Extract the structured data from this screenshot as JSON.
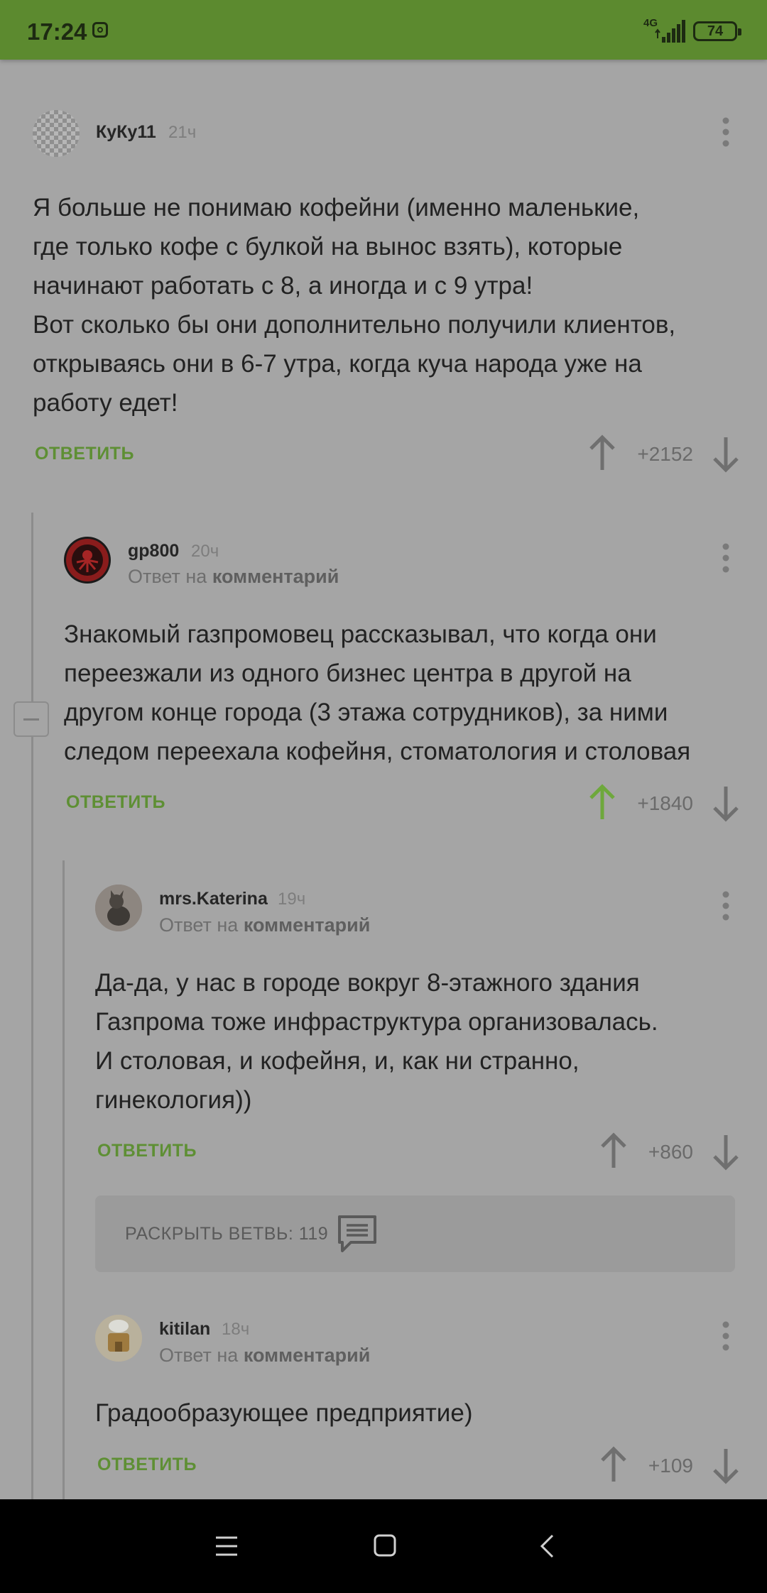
{
  "status_bar": {
    "time": "17:24",
    "network": "4G",
    "battery": "74",
    "bg_color": "#5c8a2f"
  },
  "comments": [
    {
      "author": "КуКу11",
      "age": "21ч",
      "text": [
        "Я больше не понимаю кофейни (именно маленькие,",
        "где только кофе с булкой на вынос взять), которые",
        "начинают работать с 8, а иногда и с 9 утра!",
        "Вот сколько бы они дополнительно получили клиентов,",
        "открываясь они в 6-7 утра, когда куча народа уже на",
        "работу едет!"
      ],
      "reply_label": "ОТВЕТИТЬ",
      "score": "+2152"
    },
    {
      "author": "gp800",
      "age": "20ч",
      "reply_prefix": "Ответ на",
      "reply_link": "комментарий",
      "text": [
        "Знакомый газпромовец рассказывал, что когда они",
        "переезжали из одного бизнес центра в другой на",
        "другом конце города (3 этажа сотрудников), за ними",
        "следом переехала кофейня, стоматология и столовая"
      ],
      "reply_label": "ОТВЕТИТЬ",
      "score": "+1840",
      "upvoted": true
    },
    {
      "author": "mrs.Katerina",
      "age": "19ч",
      "reply_prefix": "Ответ на",
      "reply_link": "комментарий",
      "text": [
        "Да-да, у нас в городе вокруг 8-этажного здания",
        "Газпрома тоже инфраструктура организовалась.",
        "И столовая, и кофейня, и, как ни странно,",
        "гинекология))"
      ],
      "reply_label": "ОТВЕТИТЬ",
      "score": "+860"
    },
    {
      "author": "kitilan",
      "age": "18ч",
      "reply_prefix": "Ответ на",
      "reply_link": "комментарий",
      "text": [
        "Градообразующее предприятие)"
      ],
      "reply_label": "ОТВЕТИТЬ",
      "score": "+109"
    }
  ],
  "expand_branch": {
    "label": "РАСКРЫТЬ ВЕТВЬ: 119"
  },
  "colors": {
    "accent_green": "#5e8f34",
    "upvote_active": "#6ea83c",
    "overlay_gray": "#a5a5a5"
  }
}
